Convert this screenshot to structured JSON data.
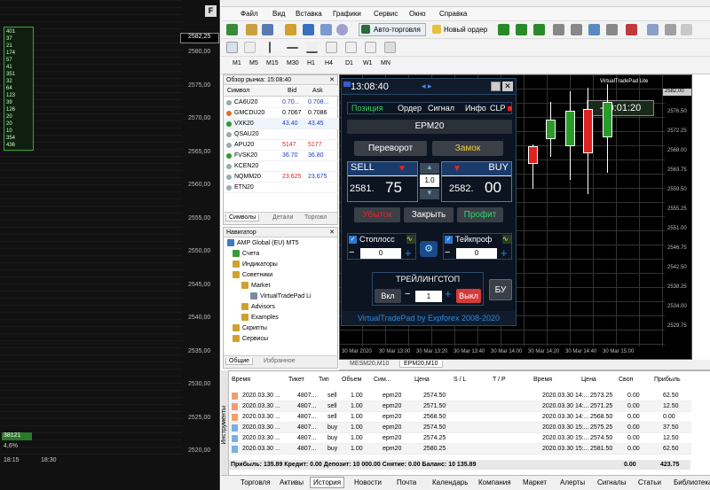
{
  "left_chart": {
    "price_labels": [
      "2580,00",
      "2575,00",
      "2570,00",
      "2565,00",
      "2560,00",
      "2555,00",
      "2550,00",
      "2545,00",
      "2540,00",
      "2535,00",
      "2530,00",
      "2525,00",
      "2520,00"
    ],
    "current_price": "2582,25",
    "dom_values": [
      "401",
      "37",
      "21",
      "174",
      "57",
      "41",
      "351",
      "32",
      "64",
      "123",
      "39",
      "126",
      "20",
      "20",
      "10",
      "354",
      "436"
    ],
    "green_box": "38121",
    "percent": "4,6%",
    "time_labels": [
      "18:15",
      "18:30"
    ]
  },
  "menu": [
    "Файл",
    "Вид",
    "Вставка",
    "Графики",
    "Сервис",
    "Окно",
    "Справка"
  ],
  "toolbar": {
    "autotrade": "Авто-торговля",
    "new_order": "Новый ордер"
  },
  "timeframes": [
    "M1",
    "M5",
    "M15",
    "M30",
    "H1",
    "H4",
    "D1",
    "W1",
    "MN"
  ],
  "market_watch": {
    "title": "Обзор рынка: 15:08:40",
    "headers": [
      "Символ",
      "Bid",
      "Ask"
    ],
    "rows": [
      {
        "sym": "CA6U20",
        "bid": "0.70...",
        "ask": "0.708...",
        "bidcolor": "#1a3fbf",
        "askcolor": "#1a3fbf"
      },
      {
        "sym": "GMCDU20",
        "bid": "0.7067",
        "ask": "0.7086",
        "bidcolor": "#000",
        "askcolor": "#000"
      },
      {
        "sym": "VXK20",
        "bid": "43.40",
        "ask": "43.45",
        "bidcolor": "#1a3fbf",
        "askcolor": "#1a3fbf"
      },
      {
        "sym": "QSAU20",
        "bid": "",
        "ask": "",
        "bidcolor": "#000",
        "askcolor": "#000"
      },
      {
        "sym": "APU20",
        "bid": "5147",
        "ask": "5177",
        "bidcolor": "#d22",
        "askcolor": "#d22"
      },
      {
        "sym": "FVSK20",
        "bid": "36.70",
        "ask": "36.80",
        "bidcolor": "#1a3fbf",
        "askcolor": "#1a3fbf"
      },
      {
        "sym": "KCEN20",
        "bid": "",
        "ask": "",
        "bidcolor": "#000",
        "askcolor": "#000"
      },
      {
        "sym": "NQMM20",
        "bid": "23.625",
        "ask": "23.675",
        "bidcolor": "#d22",
        "askcolor": "#1a3fbf"
      },
      {
        "sym": "ETN20",
        "bid": "",
        "ask": "",
        "bidcolor": "#000",
        "askcolor": "#000"
      }
    ],
    "tabs": [
      "Символы",
      "Детали",
      "Торговл"
    ]
  },
  "navigator": {
    "title": "Навигатор",
    "items": [
      "AMP Global (EU) MT5",
      "Счета",
      "Индикаторы",
      "Советники",
      "Market",
      "VirtualTradePad Li",
      "Advisors",
      "Examples",
      "Скрипты",
      "Сервисы"
    ],
    "tabs": [
      "Общие",
      "Избранное"
    ]
  },
  "chart": {
    "symbol_label": "VirtualTradePad Lite",
    "price_labels": [
      "2582.00",
      "2576.50",
      "2572.25",
      "2568.00",
      "2563.75",
      "2559.50",
      "2555.25",
      "2551.00",
      "2546.75",
      "2542.50",
      "2538.25",
      "2534.00",
      "2529.75"
    ],
    "price_tag": "2582.00",
    "time_labels": [
      "30 Mar 2020",
      "30 Mar 13:00",
      "30 Mar 13:20",
      "30 Mar 13:40",
      "30 Mar 14:00",
      "30 Mar 14:20",
      "30 Mar 14:40",
      "30 Mar 15:00"
    ],
    "timer": "-00:01:20",
    "tabs": [
      "MESM20,M10",
      "EPM20,M10"
    ]
  },
  "pad": {
    "time": "13:08:40",
    "tabs": [
      "Позиция",
      "Ордер",
      "Сигнал",
      "Инфо",
      "CLP"
    ],
    "symbol": "EPM20",
    "reverse": "Переворот",
    "lock": "Замок",
    "sell": "SELL",
    "buy": "BUY",
    "sell_price_a": "2581.",
    "sell_price_b": "75",
    "buy_price_a": "2582.",
    "buy_price_b": "00",
    "lot": "1.0",
    "loss": "Убыток",
    "close": "Закрыть",
    "profit": "Профит",
    "stoploss": "Стоплосс",
    "takeprofit": "Тейкпроф",
    "sl_val": "0",
    "tp_val": "0",
    "trailing": "ТРЕЙЛИНГСТОП",
    "on": "Вкл",
    "tr_val": "1",
    "off": "Выкл",
    "bu": "БУ",
    "footer": "VirtualTradePad by Expforex 2008-2020"
  },
  "terminal": {
    "headers": [
      "Время",
      "Тикет",
      "Тип",
      "Объем",
      "Сим...",
      "Цена",
      "S / L",
      "T / P",
      "Время",
      "Цена",
      "Своп",
      "Прибыль"
    ],
    "rows": [
      [
        "2020.03.30 ...",
        "4807...",
        "sell",
        "1.00",
        "epm20",
        "2574.50",
        "",
        "",
        "2020.03.30 14:...",
        "2573.25",
        "0.00",
        "62.50"
      ],
      [
        "2020.03.30 ...",
        "4807...",
        "sell",
        "1.00",
        "epm20",
        "2571.50",
        "",
        "",
        "2020.03.30 14:...",
        "2571.25",
        "0.00",
        "12.50"
      ],
      [
        "2020.03.30 ...",
        "4807...",
        "sell",
        "1.00",
        "epm20",
        "2568.50",
        "",
        "",
        "2020.03.30 14:...",
        "2568.50",
        "0.00",
        "0.00"
      ],
      [
        "2020.03.30 ...",
        "4807...",
        "buy",
        "1.00",
        "epm20",
        "2574.50",
        "",
        "",
        "2020.03.30 15:...",
        "2575.25",
        "0.00",
        "37.50"
      ],
      [
        "2020.03.30 ...",
        "4807...",
        "buy",
        "1.00",
        "epm20",
        "2574.25",
        "",
        "",
        "2020.03.30 15:...",
        "2574.50",
        "0.00",
        "12.50"
      ],
      [
        "2020.03.30 ...",
        "4807...",
        "buy",
        "1.00",
        "epm20",
        "2580.25",
        "",
        "",
        "2020.03.30 15:...",
        "2581.50",
        "0.00",
        "62.50"
      ]
    ],
    "totals": "Прибыль: 135.89  Кредит: 0.00  Депозит: 10 000.00  Снятие: 0.00  Баланс: 10 135.89",
    "total_swap": "0.00",
    "total_profit": "423.75",
    "side_label": "Инструменты",
    "tabs": [
      "Торговля",
      "Активы",
      "История",
      "Новости",
      "Почта",
      "Календарь",
      "Компания",
      "Маркет",
      "Алерты",
      "Сигналы",
      "Статьи",
      "Библиотека"
    ]
  }
}
